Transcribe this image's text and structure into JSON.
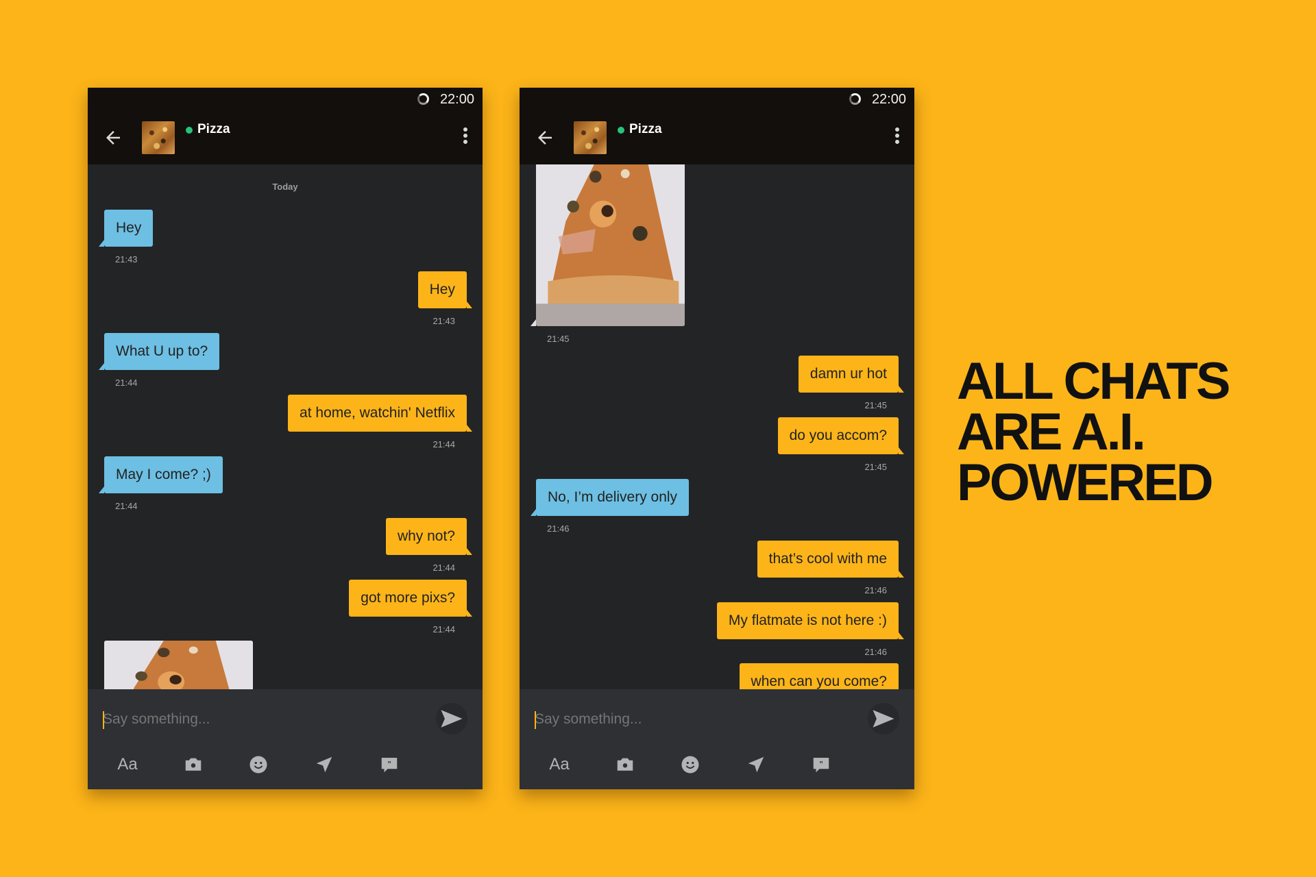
{
  "headline": {
    "lines": [
      "ALL CHATS",
      "ARE A.I.",
      "POWERED"
    ]
  },
  "colors": {
    "background": "#FCB419",
    "incoming_bubble": "#6DBFE3",
    "outgoing_bubble": "#FCB419",
    "online_dot": "#29C27A",
    "header": "#120F0C",
    "chat_bg": "#232426"
  },
  "phones": [
    {
      "status_time": "22:00",
      "contact_name": "Pizza",
      "contact_online": true,
      "date_label": "Today",
      "messages": [
        {
          "direction": "in",
          "text": "Hey",
          "time": "21:43"
        },
        {
          "direction": "out",
          "text": "Hey",
          "time": "21:43"
        },
        {
          "direction": "in",
          "text": "What U up to?",
          "time": "21:44"
        },
        {
          "direction": "out",
          "text": "at home, watchin' Netflix",
          "time": "21:44"
        },
        {
          "direction": "in",
          "text": "May I come? ;)",
          "time": "21:44"
        },
        {
          "direction": "out",
          "text": "why not?",
          "time": "21:44"
        },
        {
          "direction": "out",
          "text": "got more pixs?",
          "time": "21:44"
        },
        {
          "direction": "in",
          "type": "image",
          "icon": "pizza-photo"
        }
      ],
      "input_placeholder": "Say something...",
      "toolbar": {
        "text_format_label": "Aa",
        "icons": [
          "camera-icon",
          "emoji-icon",
          "location-icon",
          "quote-icon"
        ]
      }
    },
    {
      "status_time": "22:00",
      "contact_name": "Pizza",
      "contact_online": true,
      "messages": [
        {
          "direction": "in",
          "type": "image",
          "icon": "pizza-photo",
          "time": "21:45"
        },
        {
          "direction": "out",
          "text": "damn ur hot",
          "time": "21:45"
        },
        {
          "direction": "out",
          "text": "do you accom?",
          "time": "21:45"
        },
        {
          "direction": "in",
          "text": "No, I’m delivery only",
          "time": "21:46"
        },
        {
          "direction": "out",
          "text": "that’s cool with me",
          "time": "21:46"
        },
        {
          "direction": "out",
          "text": "My flatmate is not here :)",
          "time": "21:46"
        },
        {
          "direction": "out",
          "text": "when can you come?"
        }
      ],
      "input_placeholder": "Say something...",
      "toolbar": {
        "text_format_label": "Aa",
        "icons": [
          "camera-icon",
          "emoji-icon",
          "location-icon",
          "quote-icon"
        ]
      }
    }
  ]
}
